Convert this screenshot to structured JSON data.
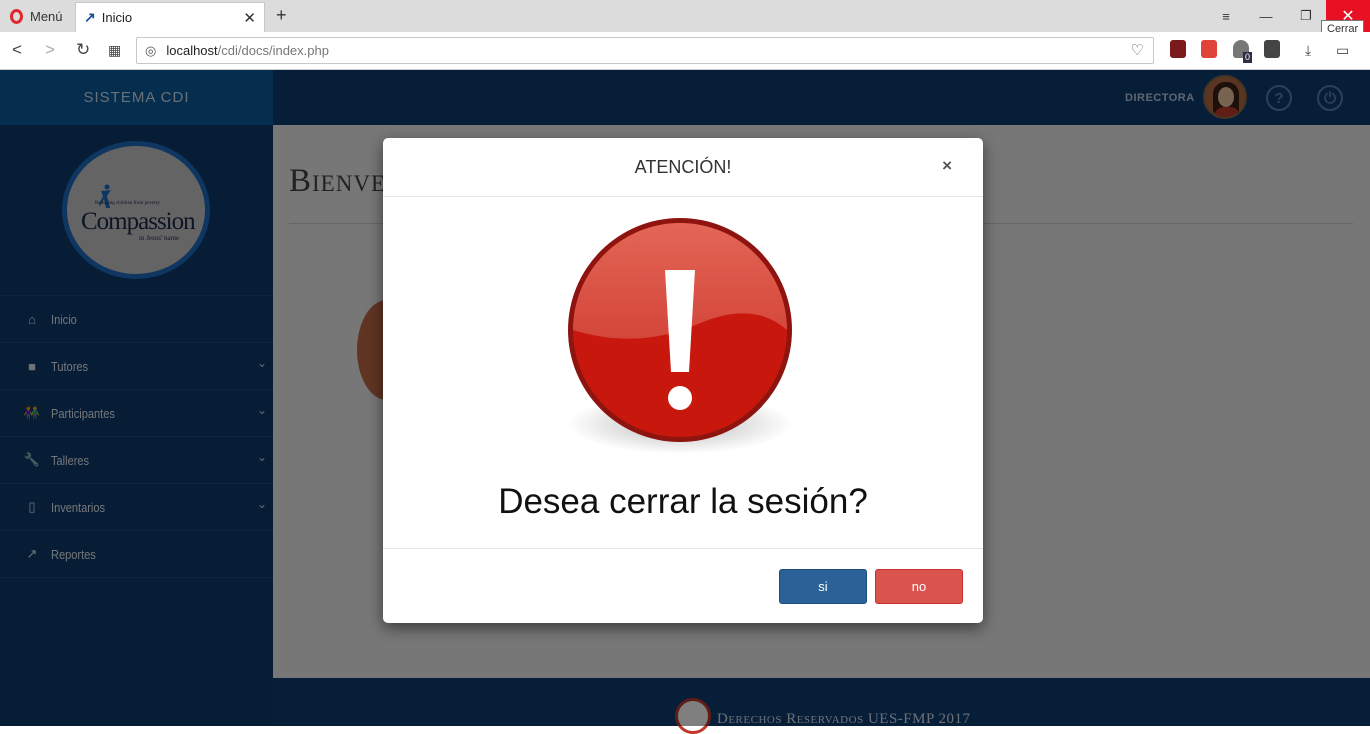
{
  "browser": {
    "menu_label": "Menú",
    "tab_title": "Inicio",
    "url_host": "localhost",
    "url_path": "/cdi/docs/index.php",
    "close_tooltip": "Cerrar",
    "badge_count": "0"
  },
  "app": {
    "brand": "SISTEMA CDI",
    "role": "DIRECTORA",
    "logo": {
      "word": "Compassion",
      "tagline": "Releasing children from poverty",
      "sub": "in Jesus' name"
    },
    "welcome": "Bienvenida",
    "footer": "Derechos Reservados UES-FMP 2017"
  },
  "sidebar": {
    "items": [
      {
        "label": "Inicio",
        "icon": "home-icon",
        "expandable": false
      },
      {
        "label": "Tutores",
        "icon": "briefcase-icon",
        "expandable": true
      },
      {
        "label": "Participantes",
        "icon": "people-icon",
        "expandable": true
      },
      {
        "label": "Talleres",
        "icon": "wrench-icon",
        "expandable": true
      },
      {
        "label": "Inventarios",
        "icon": "clipboard-icon",
        "expandable": true
      },
      {
        "label": "Reportes",
        "icon": "trend-icon",
        "expandable": false
      }
    ]
  },
  "modal": {
    "title": "ATENCIÓN!",
    "close_glyph": "×",
    "message": "Desea cerrar la sesión?",
    "yes_label": "si",
    "no_label": "no",
    "colors": {
      "yes": "#2a6298",
      "no": "#d9534f",
      "alert": "#d0231b"
    }
  }
}
